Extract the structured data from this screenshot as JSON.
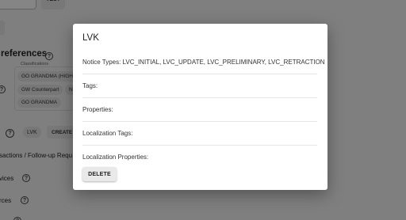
{
  "background": {
    "top_button_label": "TEST",
    "preferences_title": "references",
    "classifications_label": "Classifications",
    "classification_chips": [
      "GO GRANDMA (HIGH",
      "GW Counterpart",
      "N",
      "GO GRANDMA"
    ],
    "lvk_chip": "LVK",
    "create_button": "CREATE",
    "transactions_label": "sactions / Follow-up Requ",
    "services_label": "vices",
    "sources_label": "rces"
  },
  "dialog": {
    "title": "LVK",
    "notice_types": "Notice Types: LVC_INITIAL, LVC_UPDATE, LVC_PRELIMINARY, LVC_RETRACTION",
    "tags": "Tags:",
    "properties": "Properties:",
    "localization_tags": "Localization Tags:",
    "localization_properties": "Localization Properties:",
    "delete_label": "DELETE"
  }
}
